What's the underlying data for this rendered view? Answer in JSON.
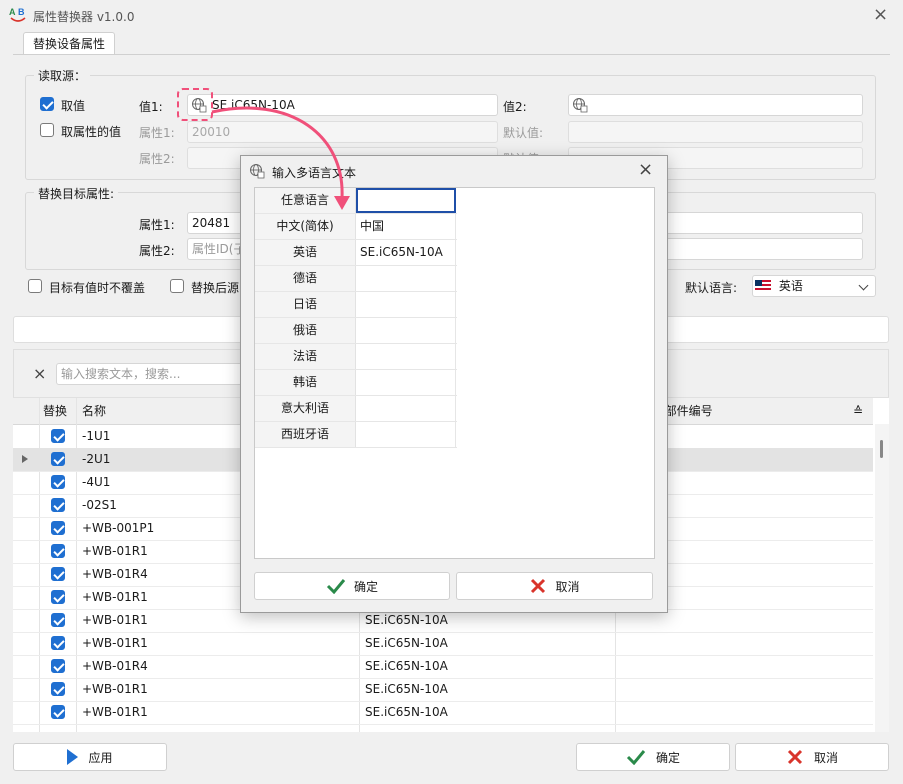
{
  "window": {
    "title": "属性替换器 v1.0.0",
    "logo_text": "A B",
    "close_label": "×"
  },
  "tab": {
    "label": "替换设备属性"
  },
  "source": {
    "legend": "读取源：",
    "take_value": {
      "label": "取值",
      "checked": true
    },
    "take_attr_value": {
      "label": "取属性的值",
      "checked": false
    },
    "value1": {
      "label": "值1:",
      "text": "SE.iC65N-10A"
    },
    "value2": {
      "label": "值2:",
      "text": ""
    },
    "attr1": {
      "label": "属性1:",
      "text": "20010"
    },
    "default_value": {
      "label": "默认值:",
      "text": ""
    },
    "attr2": {
      "label": "属性2:",
      "text": ""
    },
    "default_value2": {
      "label": "默认值:",
      "text": ""
    }
  },
  "target": {
    "legend": "替换目标属性:",
    "attr1": {
      "label": "属性1:",
      "text": "20481"
    },
    "attr2": {
      "label": "属性2:",
      "placeholder": "属性ID(子"
    }
  },
  "options": {
    "no_overwrite": {
      "label": "目标有值时不覆盖",
      "checked": false
    },
    "after_replace": {
      "label": "替换后源",
      "checked": false
    },
    "default_lang_label": "默认语言:",
    "default_lang_value": "英语"
  },
  "search": {
    "clear_icon": "×",
    "placeholder": "输入搜索文本，搜索..."
  },
  "grid": {
    "headers": {
      "replace": "替换",
      "name": "名称",
      "col3": "1:部件编号",
      "sort_icon": "≙"
    },
    "rows": [
      {
        "checked": true,
        "name": "-1U1",
        "part": ""
      },
      {
        "checked": true,
        "name": "-2U1",
        "part": "",
        "selected": true
      },
      {
        "checked": true,
        "name": "-4U1",
        "part": ""
      },
      {
        "checked": true,
        "name": "-02S1",
        "part": ""
      },
      {
        "checked": true,
        "name": "+WB-001P1",
        "part": ""
      },
      {
        "checked": true,
        "name": "+WB-01R1",
        "part": ""
      },
      {
        "checked": true,
        "name": "+WB-01R4",
        "part": ""
      },
      {
        "checked": true,
        "name": "+WB-01R1",
        "part": ""
      },
      {
        "checked": true,
        "name": "+WB-01R1",
        "part": "SE.iC65N-10A"
      },
      {
        "checked": true,
        "name": "+WB-01R1",
        "part": "SE.iC65N-10A"
      },
      {
        "checked": true,
        "name": "+WB-01R4",
        "part": "SE.iC65N-10A"
      },
      {
        "checked": true,
        "name": "+WB-01R1",
        "part": "SE.iC65N-10A"
      },
      {
        "checked": true,
        "name": "+WB-01R1",
        "part": "SE.iC65N-10A"
      }
    ]
  },
  "bottom": {
    "apply": "应用",
    "ok": "确定",
    "cancel": "取消"
  },
  "dialog": {
    "title": "输入多语言文本",
    "close": "×",
    "rows": [
      {
        "lang": "任意语言",
        "value": ""
      },
      {
        "lang": "中文(简体)",
        "value": "中国"
      },
      {
        "lang": "英语",
        "value": "SE.iC65N-10A"
      },
      {
        "lang": "德语",
        "value": ""
      },
      {
        "lang": "日语",
        "value": ""
      },
      {
        "lang": "俄语",
        "value": ""
      },
      {
        "lang": "法语",
        "value": ""
      },
      {
        "lang": "韩语",
        "value": ""
      },
      {
        "lang": "意大利语",
        "value": ""
      },
      {
        "lang": "西班牙语",
        "value": ""
      }
    ],
    "ok": "确定",
    "cancel": "取消"
  },
  "colors": {
    "accent": "#1f6fd1",
    "annotation": "#f0507a",
    "ok_green": "#2a8a4a",
    "cancel_red": "#d9342b"
  }
}
